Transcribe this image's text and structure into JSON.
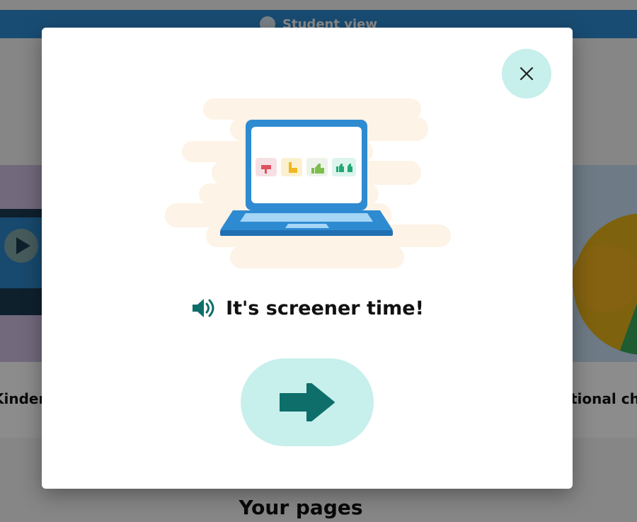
{
  "background": {
    "topbar_label": "Student view",
    "cards": [
      {
        "caption": "Kinderg"
      },
      {
        "caption": "tional che"
      }
    ],
    "section_title": "Your pages"
  },
  "modal": {
    "title": "It's screener time!",
    "icons": {
      "close": "close-icon",
      "sound": "speaker-icon",
      "next": "arrow-right-icon"
    },
    "colors": {
      "button_bg": "#c7efec",
      "accent": "#0e6e6a",
      "laptop": "#2e8bd2"
    }
  }
}
